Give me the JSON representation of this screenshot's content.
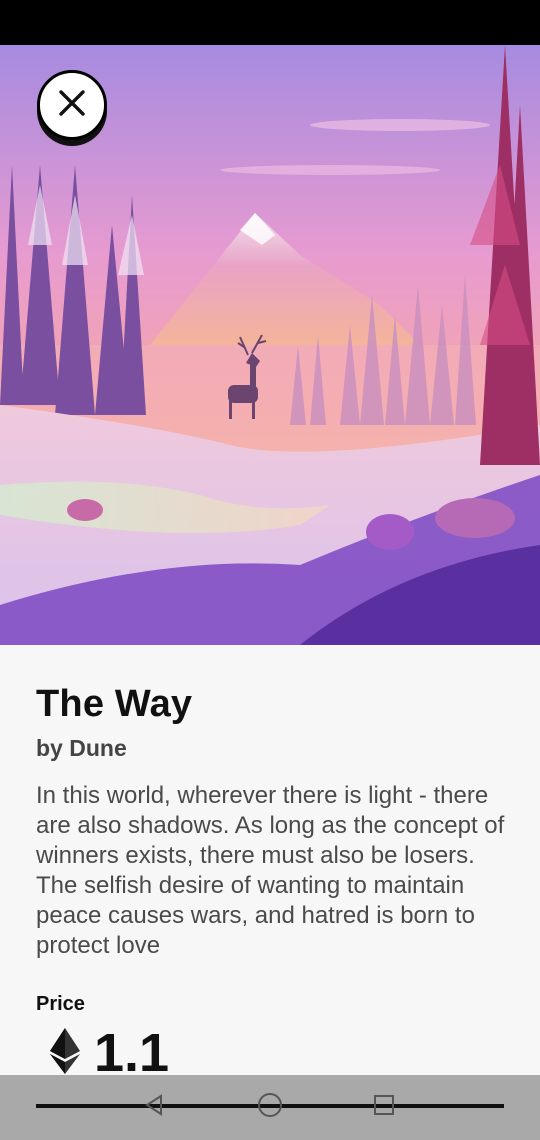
{
  "nft": {
    "title": "The Way",
    "artist": "by Dune",
    "description": "In this world, wherever there is light - there are also shadows. As long as the concept of winners exists, there must also be losers. The selfish desire of wanting to maintain peace causes wars, and hatred is born to protect love",
    "price_label": "Price",
    "price_value": "1.1",
    "currency_icon": "ethereum-icon"
  },
  "icons": {
    "close": "close-icon",
    "back": "back-triangle-icon",
    "home": "home-circle-icon",
    "recents": "recents-square-icon"
  },
  "colors": {
    "sky_top": "#b28ad8",
    "sky_mid": "#e89ac6",
    "sky_horizon": "#f7b68c",
    "snow": "#e8d2ea",
    "shadow_purple": "#6a3fb0"
  }
}
